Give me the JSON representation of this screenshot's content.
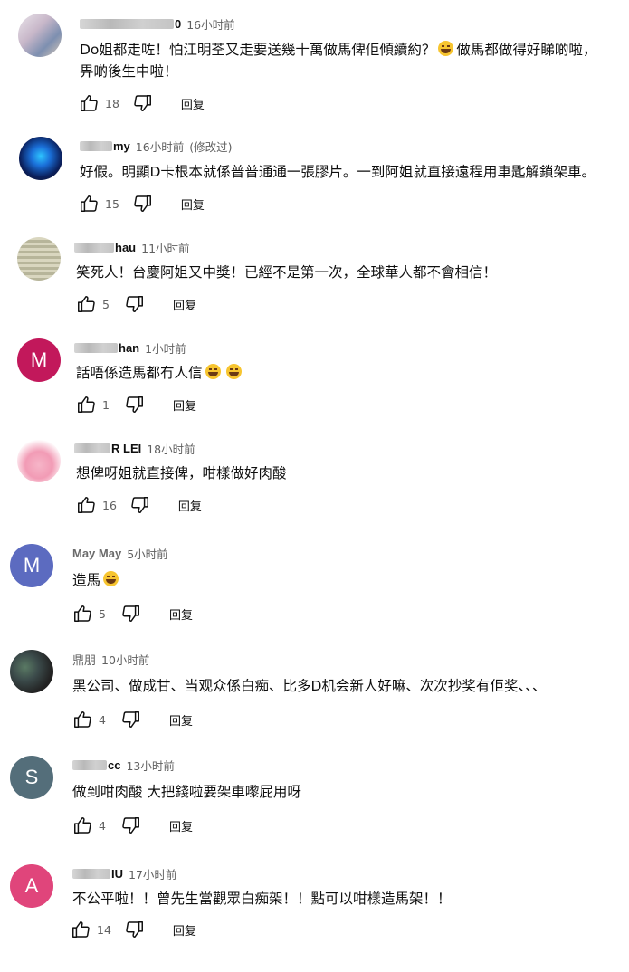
{
  "icons": {
    "like": "thumb-up-icon",
    "dislike": "thumb-down-icon"
  },
  "colors": {
    "avatar_m_pink": "#c2185b",
    "avatar_m_blue": "#5c6bc0",
    "avatar_s_gray": "#546e7a",
    "avatar_a_pink": "#e0457b",
    "meta_text": "#606060"
  },
  "comments": [
    {
      "author": "0",
      "time": "16小时前",
      "text_lines": [
        "Do姐都走咗！怕江明荃又走要送幾十萬做馬俾佢傾續約？",
        "做馬都做得好睇啲啦，",
        "畀啲後生中啦！"
      ],
      "likes": "18",
      "reply": "回复"
    },
    {
      "author": "my",
      "time": "16小时前",
      "edited": "(修改过)",
      "text_lines": [
        "好假。明顯D卡根本就係普普通通一張膠片。一到阿姐就直接遠程用車匙解鎖架車。"
      ],
      "likes": "15",
      "reply": "回复"
    },
    {
      "author": "hau",
      "time": "11小时前",
      "text_lines": [
        "笑死人！台慶阿姐又中獎！已經不是第一次，全球華人都不會相信！"
      ],
      "likes": "5",
      "reply": "回复"
    },
    {
      "author": "han",
      "avatar_letter": "M",
      "time": "1小时前",
      "text_lines": [
        "話唔係造馬都冇人信"
      ],
      "likes": "1",
      "reply": "回复"
    },
    {
      "author": "R LEI",
      "time": "18小时前",
      "text_lines": [
        "想俾呀姐就直接俾，咁樣做好肉酸"
      ],
      "likes": "16",
      "reply": "回复"
    },
    {
      "author": "May May",
      "avatar_letter": "M",
      "time": "5小时前",
      "text_lines": [
        "造馬"
      ],
      "likes": "5",
      "reply": "回复"
    },
    {
      "author": "鼎朋",
      "time": "10小时前",
      "text_lines": [
        "黑公司、做成甘、当观众係白痴、比多D机会新人好嘛、次次抄奖有佢奖、、、"
      ],
      "likes": "4",
      "reply": "回复"
    },
    {
      "author": "cc",
      "avatar_letter": "S",
      "time": "13小时前",
      "text_lines": [
        "做到咁肉酸 大把錢啦要架車嚟屁用呀"
      ],
      "likes": "4",
      "reply": "回复"
    },
    {
      "author": "IU",
      "avatar_letter": "A",
      "time": "17小时前",
      "text_lines": [
        "不公平啦！！曾先生當觀眾白痴架！！點可以咁樣造馬架！！"
      ],
      "likes": "14",
      "reply": "回复"
    }
  ]
}
